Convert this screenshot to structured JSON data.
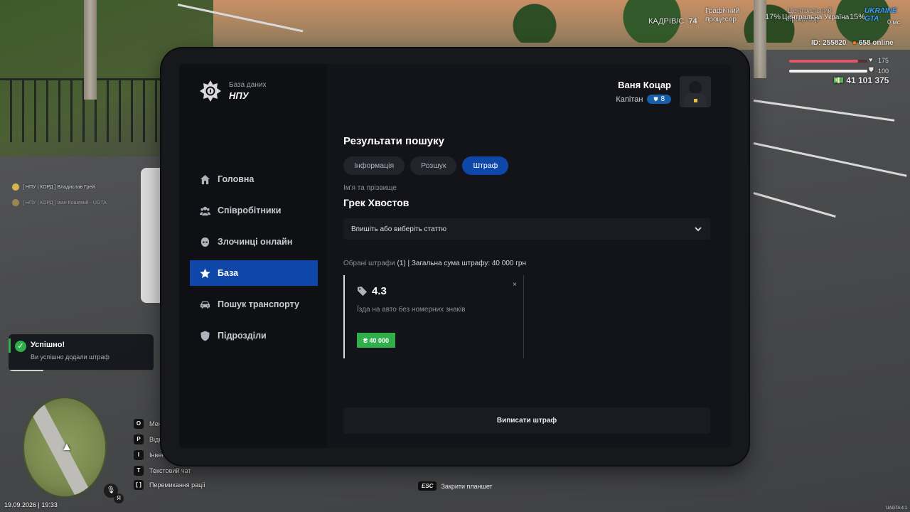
{
  "hud": {
    "frames_label": "КАДРІВ/С",
    "fps": "74",
    "gpu_label": "Графічний процесор",
    "gpu_percent": "17%",
    "cpu_label": "Центральний процесор",
    "cpu_percent": "15%",
    "server_name": "Центральна Україна",
    "logo_text": "UKRAINE GTA",
    "ping": "0 мс",
    "player_id": "ID: 255820",
    "online": "658 online",
    "health": "175",
    "armor": "100",
    "money": "41 101 375",
    "health_level": 0.88,
    "armor_level": 1.0,
    "datetime": "19.09.2026 | 19:33",
    "esc_key": "ESC",
    "esc_hint": "Закрити планшет",
    "version": "UAGTA 4.1",
    "chat": [
      {
        "text": "[ НПУ | КОРД ] Владислав Грей"
      },
      {
        "text": "[ НПУ | КОРД ] Іван Кошевий · UGTA"
      }
    ],
    "keys": [
      {
        "key": "O",
        "label": "Меню"
      },
      {
        "key": "P",
        "label": "Відкр"
      },
      {
        "key": "I",
        "label": "Інвент"
      },
      {
        "key": "T",
        "label": "Текстовий чат"
      },
      {
        "key": "[  ]",
        "label": "Перемикання раціі"
      }
    ],
    "mic_key": "Я",
    "toast": {
      "title": "Успішно!",
      "message": "Ви успішно додали штраф",
      "progress": 0.24
    }
  },
  "tablet": {
    "brand": {
      "subtitle": "База даних",
      "title": "НПУ"
    },
    "user": {
      "name": "Ваня Коцар",
      "rank": "Капітан",
      "level": "8"
    },
    "nav": [
      {
        "label": "Головна",
        "icon": "home-icon"
      },
      {
        "label": "Співробітники",
        "icon": "users-icon"
      },
      {
        "label": "Злочинці онлайн",
        "icon": "mask-icon"
      },
      {
        "label": "База",
        "icon": "star-icon"
      },
      {
        "label": "Пошук транспорту",
        "icon": "car-icon"
      },
      {
        "label": "Підрозділи",
        "icon": "shield-icon"
      }
    ],
    "active_nav": "База",
    "page_title": "Результати пошуку",
    "tabs": [
      {
        "label": "Інформація"
      },
      {
        "label": "Розшук"
      },
      {
        "label": "Штраф"
      }
    ],
    "active_tab": "Штраф",
    "person_label": "Ім'я та прізвище",
    "person_name": "Грек Хвостов",
    "article_select": {
      "placeholder": "Впишіть або виберіть статтю"
    },
    "summary": {
      "label": "Обрані штрафи",
      "count": "(1)",
      "total": "| Загальна сума штрафу: 40 000 грн"
    },
    "fine": {
      "code": "4.3",
      "description": "Їзда на авто без номерних знаків",
      "amount": "₴ 40 000",
      "close": "×"
    },
    "submit_label": "Виписати штраф"
  },
  "colors": {
    "accent": "#0f47a9",
    "success": "#2fae4a",
    "health": "#e0566a",
    "panel": "#13141a"
  }
}
